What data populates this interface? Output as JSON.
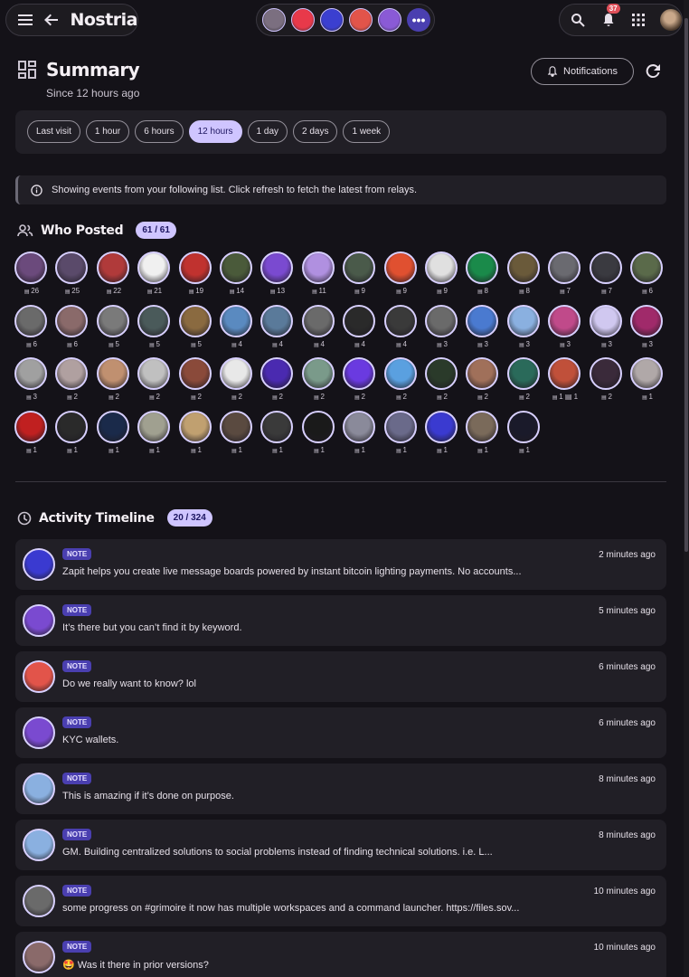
{
  "app": {
    "name": "Nostria"
  },
  "topbar": {
    "menu_icon": "menu-icon",
    "back_icon": "back-arrow-icon",
    "accounts": [
      "#7b6f80",
      "#e8394a",
      "#3b3fd0",
      "#e2544a",
      "#8a5ad6"
    ],
    "more_label": "•••",
    "notification_count": "37"
  },
  "summary": {
    "title": "Summary",
    "subtitle": "Since 12 hours ago",
    "notifications_button": "Notifications"
  },
  "time_ranges": [
    {
      "label": "Last visit",
      "active": false
    },
    {
      "label": "1 hour",
      "active": false
    },
    {
      "label": "6 hours",
      "active": false
    },
    {
      "label": "12 hours",
      "active": true
    },
    {
      "label": "1 day",
      "active": false
    },
    {
      "label": "2 days",
      "active": false
    },
    {
      "label": "1 week",
      "active": false
    }
  ],
  "info_text": "Showing events from your following list. Click refresh to fetch the latest from relays.",
  "who_posted": {
    "title": "Who Posted",
    "count": "61 / 61",
    "users": [
      {
        "c": "26",
        "col": "#6b4a7c"
      },
      {
        "c": "25",
        "col": "#5a4a6a"
      },
      {
        "c": "22",
        "col": "#b03a3a"
      },
      {
        "c": "21",
        "col": "#f0f0f0"
      },
      {
        "c": "19",
        "col": "#c0322f"
      },
      {
        "c": "14",
        "col": "#4a5a3a"
      },
      {
        "c": "13",
        "col": "#7a4ad0"
      },
      {
        "c": "11",
        "col": "#b090e0"
      },
      {
        "c": "9",
        "col": "#4a5a4a"
      },
      {
        "c": "9",
        "col": "#e05030"
      },
      {
        "c": "9",
        "col": "#e0e0e0"
      },
      {
        "c": "8",
        "col": "#1a8a4a"
      },
      {
        "c": "8",
        "col": "#6a5a3a"
      },
      {
        "c": "7",
        "col": "#6a6a70"
      },
      {
        "c": "7",
        "col": "#3a3a40"
      },
      {
        "c": "6",
        "col": "#5a6a4a"
      },
      {
        "c": "6",
        "col": "#6a6a6a"
      },
      {
        "c": "6",
        "col": "#8a6a6a"
      },
      {
        "c": "5",
        "col": "#7a7a7a"
      },
      {
        "c": "5",
        "col": "#4a5a5a"
      },
      {
        "c": "5",
        "col": "#8a6a40"
      },
      {
        "c": "4",
        "col": "#5a8ac0"
      },
      {
        "c": "4",
        "col": "#5a7a9a"
      },
      {
        "c": "4",
        "col": "#6a6a6a"
      },
      {
        "c": "4",
        "col": "#2a2a2a"
      },
      {
        "c": "4",
        "col": "#3a3a3a"
      },
      {
        "c": "3",
        "col": "#6a6a6a"
      },
      {
        "c": "3",
        "col": "#4a7ad0"
      },
      {
        "c": "3",
        "col": "#8ab0e0"
      },
      {
        "c": "3",
        "col": "#c04a8a"
      },
      {
        "c": "3",
        "col": "#d0c8f0"
      },
      {
        "c": "3",
        "col": "#a02a6a"
      },
      {
        "c": "3",
        "col": "#a0a0a0"
      },
      {
        "c": "2",
        "col": "#b0a0a0"
      },
      {
        "c": "2",
        "col": "#c09070"
      },
      {
        "c": "2",
        "col": "#c0c0c0"
      },
      {
        "c": "2",
        "col": "#8a4a3a"
      },
      {
        "c": "2",
        "col": "#e8e8e8"
      },
      {
        "c": "2",
        "col": "#4a2ab0"
      },
      {
        "c": "2",
        "col": "#7a9a8a"
      },
      {
        "c": "2",
        "col": "#6a3ae0"
      },
      {
        "c": "2",
        "col": "#5aa0e0"
      },
      {
        "c": "2",
        "col": "#2a3a2a"
      },
      {
        "c": "2",
        "col": "#a0705a"
      },
      {
        "c": "2",
        "col": "#2a6a5a"
      },
      {
        "c": "1 ▤ 1",
        "col": "#c0503a"
      },
      {
        "c": "2",
        "col": "#3a2a3a"
      },
      {
        "c": "1",
        "col": "#b0a8a8"
      },
      {
        "c": "1",
        "col": "#c02020"
      },
      {
        "c": "1",
        "col": "#2a2a2a"
      },
      {
        "c": "1",
        "col": "#1a2a4a"
      },
      {
        "c": "1",
        "col": "#a0a090"
      },
      {
        "c": "1",
        "col": "#c0a070"
      },
      {
        "c": "1",
        "col": "#5a4a40"
      },
      {
        "c": "1",
        "col": "#3a3a3a"
      },
      {
        "c": "1",
        "col": "#1a1a1a"
      },
      {
        "c": "1",
        "col": "#8a8a9a"
      },
      {
        "c": "1",
        "col": "#6a6a8a"
      },
      {
        "c": "1",
        "col": "#3a3ad0"
      },
      {
        "c": "1",
        "col": "#7a6a5a"
      },
      {
        "c": "1",
        "col": "#1a1a2a"
      }
    ]
  },
  "timeline": {
    "title": "Activity Timeline",
    "count": "20 / 324",
    "items": [
      {
        "tag": "NOTE",
        "text": "Zapit helps you create live message boards powered by instant bitcoin lighting payments. No accounts...",
        "time": "2 minutes ago",
        "col": "#3a3ad0"
      },
      {
        "tag": "NOTE",
        "text": "It’s there but you can’t find it by keyword.",
        "time": "5 minutes ago",
        "col": "#7a4ad0"
      },
      {
        "tag": "NOTE",
        "text": "Do we really want to know? lol",
        "time": "6 minutes ago",
        "col": "#e2544a"
      },
      {
        "tag": "NOTE",
        "text": "KYC wallets.",
        "time": "6 minutes ago",
        "col": "#7a4ad0"
      },
      {
        "tag": "NOTE",
        "text": "This is amazing if it’s done on purpose.",
        "time": "8 minutes ago",
        "col": "#8ab0e0"
      },
      {
        "tag": "NOTE",
        "text": "GM. Building centralized solutions to social problems instead of finding technical solutions. i.e. L...",
        "time": "8 minutes ago",
        "col": "#8ab0e0"
      },
      {
        "tag": "NOTE",
        "text": "some progress on #grimoire it now has multiple workspaces and a command launcher. https://files.sov...",
        "time": "10 minutes ago",
        "col": "#6a6a6a"
      },
      {
        "tag": "NOTE",
        "text": "🤩 Was it there in prior versions?",
        "time": "10 minutes ago",
        "col": "#8a6a6a"
      }
    ]
  }
}
